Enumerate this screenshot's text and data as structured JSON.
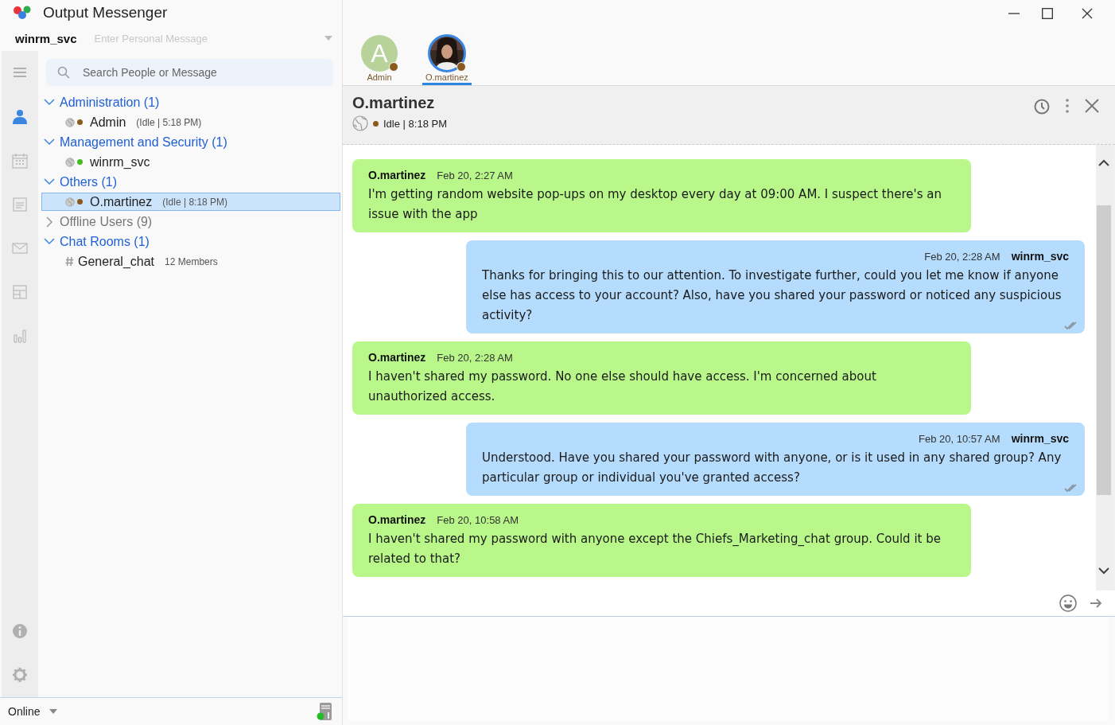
{
  "window": {
    "title": "Output Messenger"
  },
  "user": {
    "name": "winrm_svc",
    "personal_message_placeholder": "Enter Personal Message"
  },
  "rail": [
    {
      "kind": "menu",
      "selected": false
    },
    {
      "kind": "contacts",
      "selected": true
    },
    {
      "kind": "calendar",
      "selected": false
    },
    {
      "kind": "notes",
      "selected": false
    },
    {
      "kind": "mail",
      "selected": false
    },
    {
      "kind": "board",
      "selected": false
    },
    {
      "kind": "reports",
      "selected": false
    }
  ],
  "rail_bottom": [
    {
      "kind": "info"
    },
    {
      "kind": "settings"
    }
  ],
  "search": {
    "placeholder": "Search People or Message"
  },
  "tree": [
    {
      "label": "Administration (1)",
      "expanded": true,
      "children": [
        {
          "kind": "user",
          "name": "Admin",
          "detail": "(Idle  | 5:18 PM)",
          "color": "#8a5a1c",
          "selected": false
        }
      ]
    },
    {
      "label": "Management and Security (1)",
      "expanded": true,
      "children": [
        {
          "kind": "user",
          "name": "winrm_svc",
          "color": "#44bb22",
          "selected": false
        }
      ]
    },
    {
      "label": "Others (1)",
      "expanded": true,
      "children": [
        {
          "kind": "user",
          "name": "O.martinez",
          "detail": "(Idle  | 8:18 PM)",
          "color": "#8a5a1c",
          "selected": true
        }
      ]
    },
    {
      "label": "Offline Users (9)",
      "expanded": false
    },
    {
      "label": "Chat Rooms (1)",
      "expanded": true,
      "children": [
        {
          "kind": "room",
          "name": "General_chat",
          "detail": "12 Members",
          "selected": false
        }
      ]
    }
  ],
  "status_bar": {
    "status": "Online"
  },
  "chat_tabs": [
    {
      "kind": "letter",
      "initial": "A",
      "name": "Admin",
      "color": "#8a5a1c",
      "selected": false
    },
    {
      "kind": "picture",
      "name": "O.martinez",
      "color": "#8a5a1c",
      "selected": true
    }
  ],
  "chat": {
    "name": "O.martinez",
    "status": "Idle | 8:18 PM"
  },
  "messages": [
    {
      "kind": "incoming",
      "sender": "O.martinez",
      "time": "Feb 20, 2:27 AM",
      "text": "I'm getting random website pop-ups on my desktop every day at 09:00 AM. I suspect there's an issue with the app",
      "ticked": false
    },
    {
      "kind": "outgoing",
      "sender": "winrm_svc",
      "time": "Feb 20, 2:28 AM",
      "text": "Thanks for bringing this to our attention. To investigate further, could you let me know if anyone else has access to your account? Also, have you shared your password or noticed any suspicious activity?",
      "ticked": true
    },
    {
      "kind": "incoming",
      "sender": "O.martinez",
      "time": "Feb 20, 2:28 AM",
      "text": "I haven't shared my password. No one else should have access. I'm concerned about unauthorized access.",
      "ticked": false
    },
    {
      "kind": "outgoing",
      "sender": "winrm_svc",
      "time": "Feb 20, 10:57 AM",
      "text": "Understood. Have you shared your password with anyone, or is it used in any shared group? Any particular group or individual you've granted access?",
      "ticked": true
    },
    {
      "kind": "incoming",
      "sender": "O.martinez",
      "time": "Feb 20, 10:58 AM",
      "text": "I haven't shared my password with anyone except the Chiefs_Marketing_chat group. Could it be related to that?",
      "ticked": false
    }
  ]
}
